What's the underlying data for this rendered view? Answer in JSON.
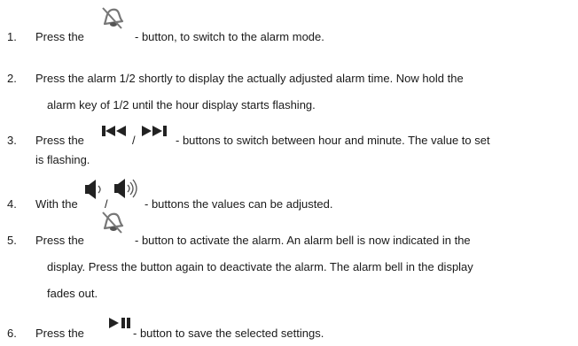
{
  "steps": [
    {
      "number": "1.",
      "before": "Press the",
      "icon": "alarm-bell-icon",
      "after": "- button, to switch to the alarm mode."
    },
    {
      "number": "2.",
      "line1": "Press the alarm 1/2 shortly to display the actually adjusted alarm time. Now hold the",
      "line2": "alarm key of 1/2 until the hour display starts flashing."
    },
    {
      "number": "3.",
      "before": "Press the",
      "icons": [
        "skip-back-icon",
        "skip-forward-icon"
      ],
      "separator": "/",
      "after": "- buttons to switch between hour and minute. The value to set",
      "line2": "is flashing."
    },
    {
      "number": "4.",
      "before": "With the",
      "icons": [
        "volume-down-icon",
        "volume-up-icon"
      ],
      "separator": "/",
      "after": "- buttons the values can be adjusted."
    },
    {
      "number": "5.",
      "before": "Press the",
      "icon": "alarm-bell-icon",
      "after": "- button to activate the alarm. An alarm bell is now indicated in the",
      "line2": "display. Press the button again to deactivate the alarm. The alarm bell in the display",
      "line3": "fades out."
    },
    {
      "number": "6.",
      "before": "Press the",
      "icon": "play-pause-icon",
      "after": "- button to save the selected settings."
    }
  ]
}
